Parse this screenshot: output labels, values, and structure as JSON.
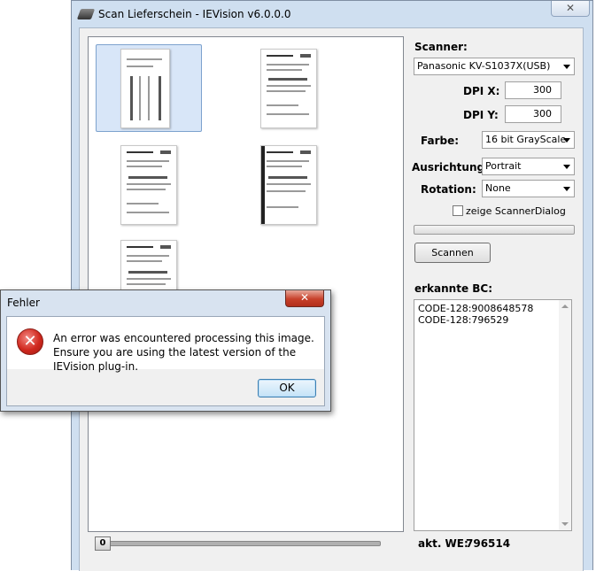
{
  "window": {
    "title": "Scan Lieferschein - IEVision v6.0.0.0",
    "close_glyph": "✕"
  },
  "slider": {
    "value": "0"
  },
  "scanner": {
    "label": "Scanner:",
    "selected": "Panasonic KV-S1037X(USB)"
  },
  "dpi_x": {
    "label": "DPI X:",
    "value": "300"
  },
  "dpi_y": {
    "label": "DPI Y:",
    "value": "300"
  },
  "farbe": {
    "label": "Farbe:",
    "selected": "16 bit GrayScale"
  },
  "ausrichtung": {
    "label": "Ausrichtung:",
    "selected": "Portrait"
  },
  "rotation": {
    "label": "Rotation:",
    "selected": "None"
  },
  "scanner_dialog": {
    "label": "zeige ScannerDialog",
    "checked": false
  },
  "scan_button": {
    "label": "Scannen"
  },
  "barcodes": {
    "label": "erkannte BC:",
    "items": [
      "CODE-128:9008648578",
      "CODE-128:796529"
    ]
  },
  "akt_we": {
    "label": "akt. WE:",
    "value": "796514"
  },
  "dialog": {
    "title": "Fehler",
    "close_glyph": "✕",
    "icon_glyph": "✕",
    "message": "An error was encountered processing this image. Ensure you are using the latest version of the IEVision plug-in.",
    "ok_label": "OK"
  }
}
